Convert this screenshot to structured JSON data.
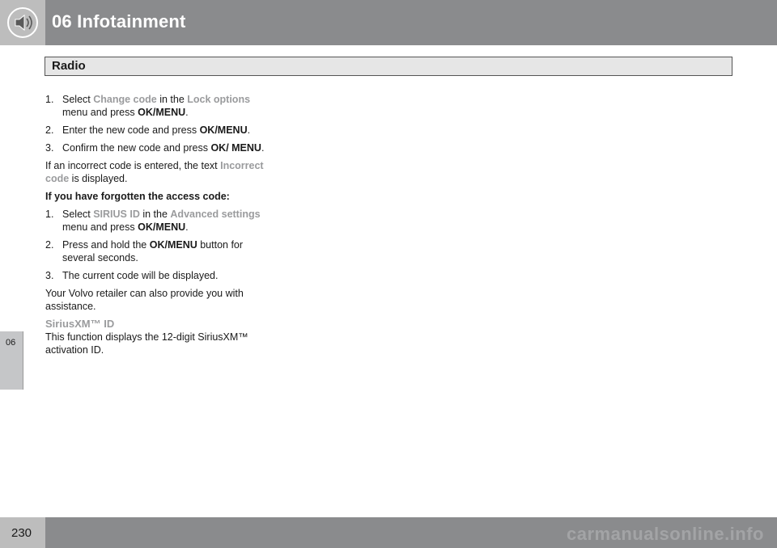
{
  "header": {
    "chapter_title": "06 Infotainment"
  },
  "section": {
    "title": "Radio"
  },
  "tab": {
    "label": "06"
  },
  "steps_a": [
    {
      "num": "1.",
      "t1": "Select ",
      "ui1": "Change code",
      "t2": " in the ",
      "ui2": "Lock options",
      "t3": " menu and press ",
      "bold": "OK/MENU",
      "t4": "."
    },
    {
      "num": "2.",
      "t1": "Enter the new code and press ",
      "bold": "OK/MENU",
      "t2": "."
    },
    {
      "num": "3.",
      "t1": "Confirm the new code and press ",
      "bold": "OK/ MENU",
      "t2": "."
    }
  ],
  "incorrect": {
    "t1": "If an incorrect code is entered, the text ",
    "ui": "Incorrect code",
    "t2": " is displayed."
  },
  "forgot_heading": "If you have forgotten the access code:",
  "steps_b": [
    {
      "num": "1.",
      "t1": "Select ",
      "ui1": "SIRIUS ID",
      "t2": " in the ",
      "ui2": "Advanced settings",
      "t3": " menu and press ",
      "bold": "OK/MENU",
      "t4": "."
    },
    {
      "num": "2.",
      "t1": "Press and hold the ",
      "bold": "OK/MENU",
      "t2": " button for several seconds."
    },
    {
      "num": "3.",
      "t1": "The current code will be displayed."
    }
  ],
  "retailer": "Your Volvo retailer can also provide you with assistance.",
  "siriusxm": {
    "heading": "SiriusXM™ ID",
    "body": "This function displays the 12-digit SiriusXM™ activation ID."
  },
  "footer": {
    "page_number": "230",
    "watermark": "carmanualsonline.info"
  }
}
